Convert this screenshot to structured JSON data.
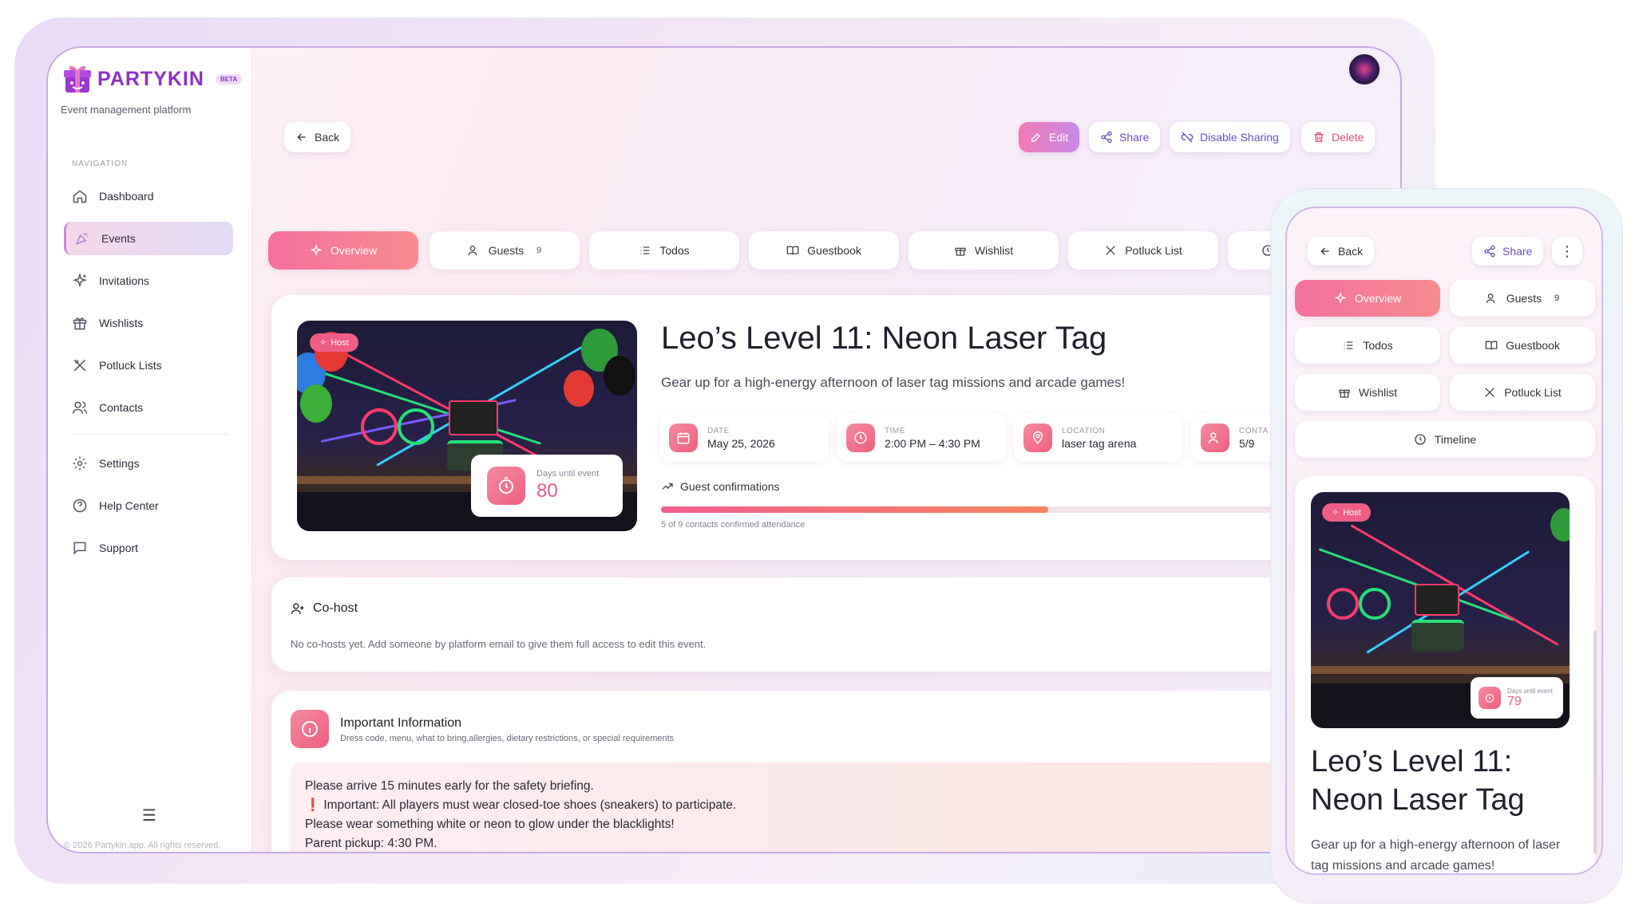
{
  "app": {
    "brand": "PARTYKIN",
    "beta": "BETA",
    "tagline": "Event management platform",
    "copyright": "© 2026 Partykin.app. All rights reserved."
  },
  "nav": {
    "heading": "NAVIGATION",
    "items": [
      {
        "label": "Dashboard",
        "icon": "home-icon"
      },
      {
        "label": "Events",
        "icon": "party-icon",
        "active": true
      },
      {
        "label": "Invitations",
        "icon": "sparkle-icon"
      },
      {
        "label": "Wishlists",
        "icon": "gift-icon"
      },
      {
        "label": "Potluck Lists",
        "icon": "utensils-icon"
      },
      {
        "label": "Contacts",
        "icon": "users-icon"
      }
    ],
    "footer_items": [
      {
        "label": "Settings",
        "icon": "gear-icon"
      },
      {
        "label": "Help Center",
        "icon": "help-icon"
      },
      {
        "label": "Support",
        "icon": "chat-icon"
      }
    ]
  },
  "toolbar": {
    "back": "Back",
    "edit": "Edit",
    "share": "Share",
    "disable_sharing": "Disable Sharing",
    "delete": "Delete"
  },
  "tabs": [
    {
      "label": "Overview",
      "active": true
    },
    {
      "label": "Guests",
      "count": "9"
    },
    {
      "label": "Todos"
    },
    {
      "label": "Guestbook"
    },
    {
      "label": "Wishlist"
    },
    {
      "label": "Potluck List"
    }
  ],
  "event": {
    "host_badge": "Host",
    "title": "Leo’s Level 11: Neon Laser Tag",
    "description": "Gear up for a high-energy afternoon of laser tag missions and arcade games!",
    "days_label": "Days until event",
    "days_value": "80",
    "info": {
      "date_label": "DATE",
      "date_value": "May 25, 2026",
      "time_label": "TIME",
      "time_value": "2:00 PM – 4:30 PM",
      "location_label": "LOCATION",
      "location_value": "laser tag arena",
      "contacts_label": "CONTA",
      "contacts_value": "5/9"
    },
    "confirm_label": "Guest confirmations",
    "confirm_fraction": 0.58,
    "confirm_note": "5 of 9 contacts confirmed attendance"
  },
  "cohost": {
    "title": "Co-host",
    "text": "No co-hosts yet. Add someone by platform email to give them full access to edit this event."
  },
  "important": {
    "title": "Important Information",
    "subtitle": "Dress code, menu, what to bring,allergies, dietary restrictions, or special requirements",
    "line1": "Please arrive 15 minutes early for the safety briefing.",
    "line2": "Important: All players must wear closed-toe shoes (sneakers) to participate.",
    "line3": "Please wear something white or neon to glow under the blacklights!",
    "line4": "Parent pickup: 4:30 PM."
  },
  "mobile": {
    "back": "Back",
    "share": "Share",
    "tabs": [
      {
        "label": "Overview",
        "active": true
      },
      {
        "label": "Guests",
        "count": "9"
      },
      {
        "label": "Todos"
      },
      {
        "label": "Guestbook"
      },
      {
        "label": "Wishlist"
      },
      {
        "label": "Potluck List"
      },
      {
        "label": "Timeline"
      }
    ],
    "host_badge": "Host",
    "days_label": "Days until event",
    "days_value": "79",
    "title": "Leo’s Level 11: Neon Laser Tag",
    "description": "Gear up for a high-energy afternoon of laser tag missions and arcade games!"
  },
  "colors": {
    "brand": "#8e2fc8",
    "accent_pink": "#f4709f",
    "danger": "#e24b6e"
  }
}
